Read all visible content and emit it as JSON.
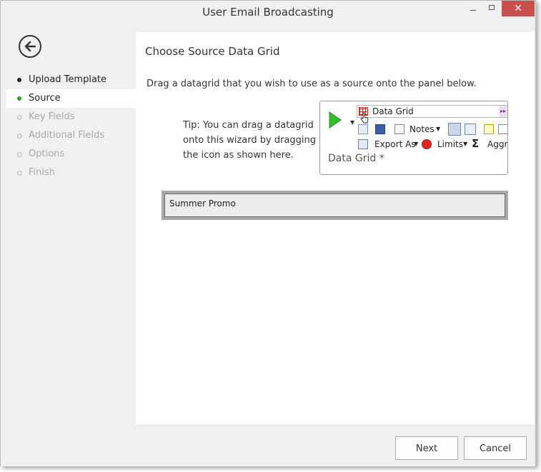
{
  "window": {
    "title": "User Email Broadcasting"
  },
  "sidebar": {
    "steps": [
      {
        "label": "Upload Template",
        "state": "done"
      },
      {
        "label": "Source",
        "state": "active"
      },
      {
        "label": "Key Fields",
        "state": "disabled"
      },
      {
        "label": "Additional Fields",
        "state": "disabled"
      },
      {
        "label": "Options",
        "state": "disabled"
      },
      {
        "label": "Finish",
        "state": "disabled"
      }
    ]
  },
  "main": {
    "heading": "Choose Source Data Grid",
    "instruction": "Drag a datagrid that you wish to use as a source onto the panel below.",
    "tip": "Tip: You can drag a datagrid onto this wizard by dragging the icon as shown here.",
    "preview": {
      "grid_label": "Data Grid",
      "notes_label": "Notes",
      "export_label": "Export As",
      "limits_label": "Limits",
      "aggr_label": "Aggr",
      "sigma": "Σ",
      "title": "Data Grid *"
    },
    "drop_panel_value": "Summer Promo"
  },
  "footer": {
    "next_label": "Next",
    "cancel_label": "Cancel"
  },
  "colors": {
    "active_dot": "#3a9a34",
    "close_button": "#c7504c",
    "play": "#2fbf2f"
  }
}
